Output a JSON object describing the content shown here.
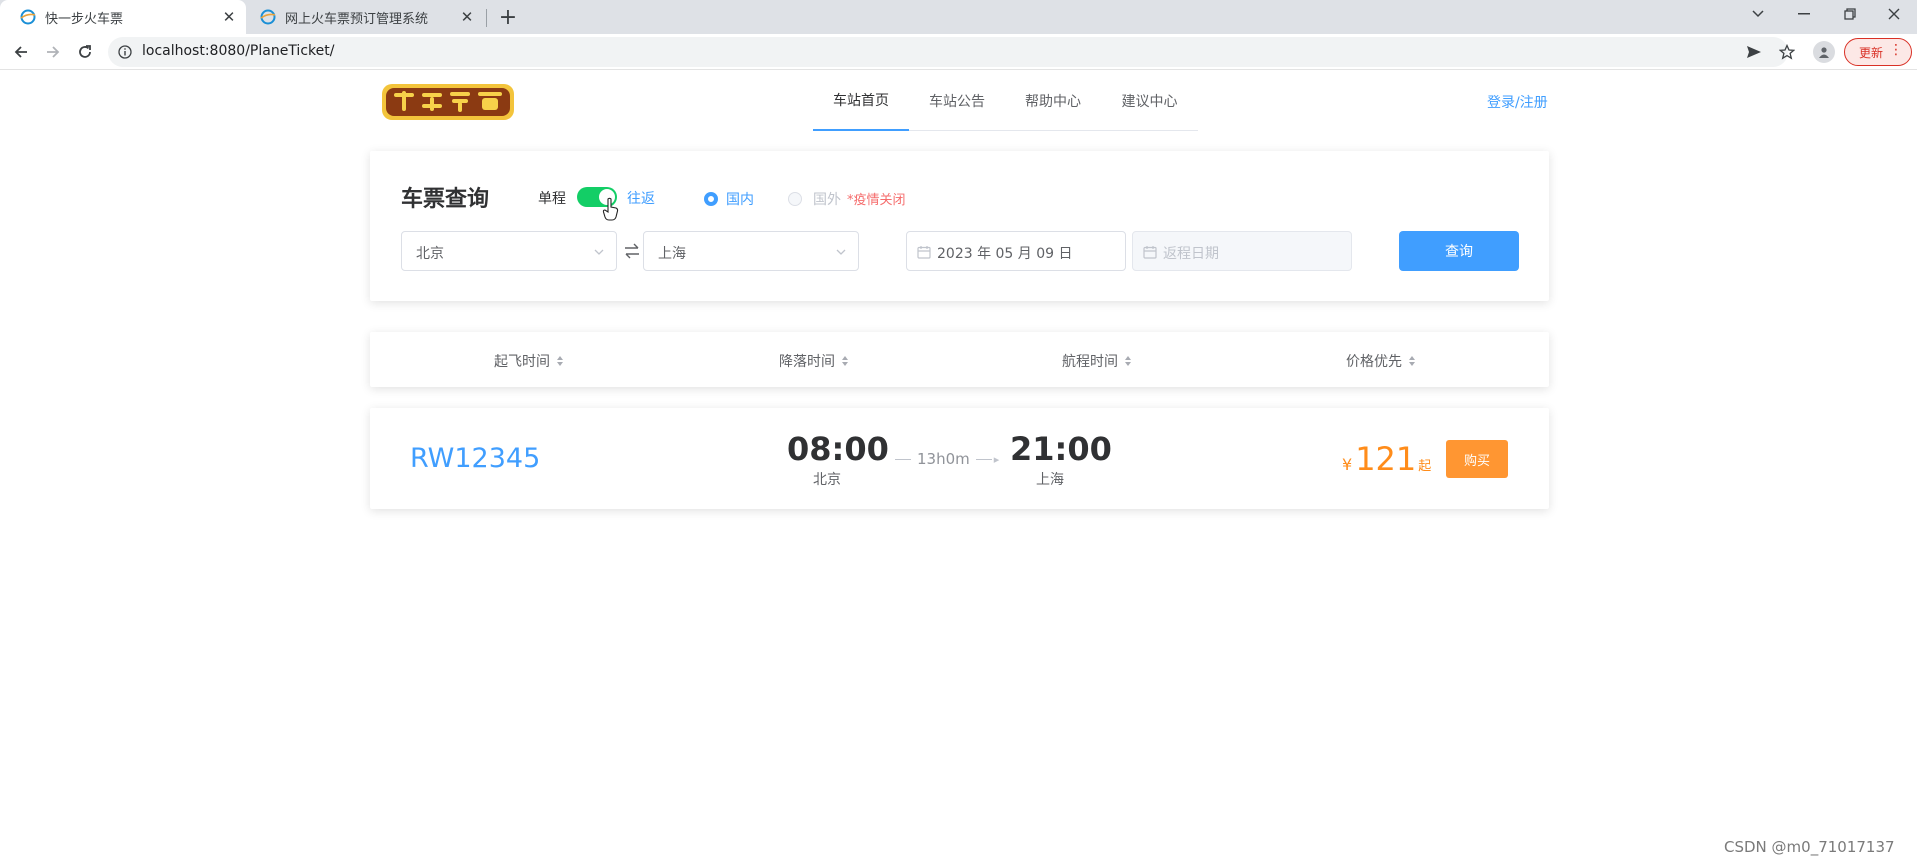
{
  "browser": {
    "tabs": [
      {
        "title": "快一步火车票",
        "active": true
      },
      {
        "title": "网上火车票预订管理系统",
        "active": false
      }
    ],
    "url": "localhost:8080/PlaneTicket/",
    "update_label": "更新"
  },
  "header": {
    "logo_alt": "火车票预定",
    "nav": [
      "车站首页",
      "车站公告",
      "帮助中心",
      "建议中心"
    ],
    "active_nav": "车站首页",
    "login_label": "登录/注册"
  },
  "search": {
    "title": "车票查询",
    "one_way_label": "单程",
    "round_trip_label": "往返",
    "domestic_label": "国内",
    "international_label": "国外",
    "covid_note": "*疫情关闭",
    "from": "北京",
    "to": "上海",
    "depart_date": "2023 年 05 月 09 日",
    "return_placeholder": "返程日期",
    "search_button": "查询"
  },
  "sort": {
    "depart_time": "起飞时间",
    "arrive_time": "降落时间",
    "duration": "航程时间",
    "price_first": "价格优先"
  },
  "results": [
    {
      "train_no": "RW12345",
      "depart_time": "08:00",
      "depart_station": "北京",
      "duration": "13h0m",
      "arrive_time": "21:00",
      "arrive_station": "上海",
      "currency": "¥",
      "price": "121",
      "price_suffix": "起",
      "buy_label": "购买"
    }
  ],
  "watermark": "CSDN @m0_71017137",
  "colors": {
    "primary": "#409eff",
    "switch_on": "#13ce66",
    "price": "#ff8c1a",
    "buy": "#ff9632",
    "danger": "#f56c6c"
  }
}
